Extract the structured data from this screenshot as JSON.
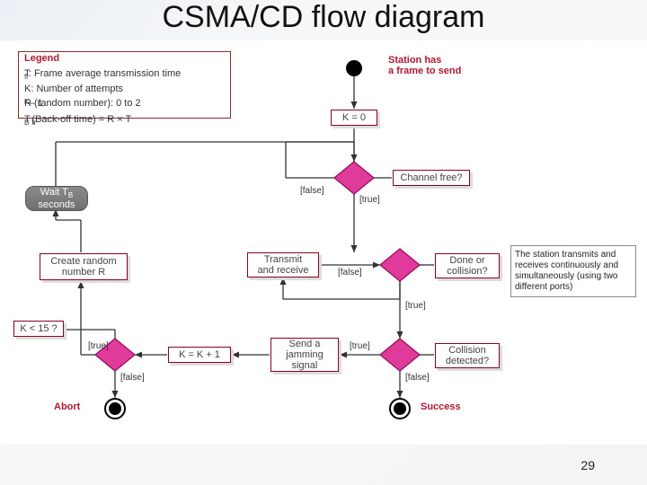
{
  "title": "CSMA/CD flow diagram",
  "page_number": "29",
  "legend": {
    "heading": "Legend",
    "l1_pre": "T",
    "l1_sub": "fr",
    "l1_post": ": Frame average transmission time",
    "l2": "K: Number of attempts",
    "l3_pre": "R (random number): 0 to 2",
    "l3_sup": "K",
    "l3_post": " – 1",
    "l4_pre": "T",
    "l4_sub": "B",
    "l4_mid": "(Back-off time) = R × T",
    "l4_sub2": "fr"
  },
  "nodes": {
    "start_label": "Station has\na frame to send",
    "k_init": "K = 0",
    "channel_free": "Channel free?",
    "wait_tb_pre": "Wait T",
    "wait_tb_sub": "B",
    "wait_tb_post": "seconds",
    "create_r": "Create random\nnumber R",
    "transmit": "Transmit\nand receive",
    "done_collision": "Done or\ncollision?",
    "k_lt_15": "K < 15 ?",
    "k_inc": "K = K + 1",
    "jamming": "Send a\njamming\nsignal",
    "collision_detected": "Collision\ndetected?",
    "abort": "Abort",
    "success": "Success"
  },
  "edge_labels": {
    "true": "[true]",
    "false": "[false]"
  },
  "annotation": "The station transmits and receives continuously and simultaneously (using two different ports)",
  "colors": {
    "magenta": "#d61a7f",
    "maroon": "#b01832",
    "grey": "#777"
  }
}
